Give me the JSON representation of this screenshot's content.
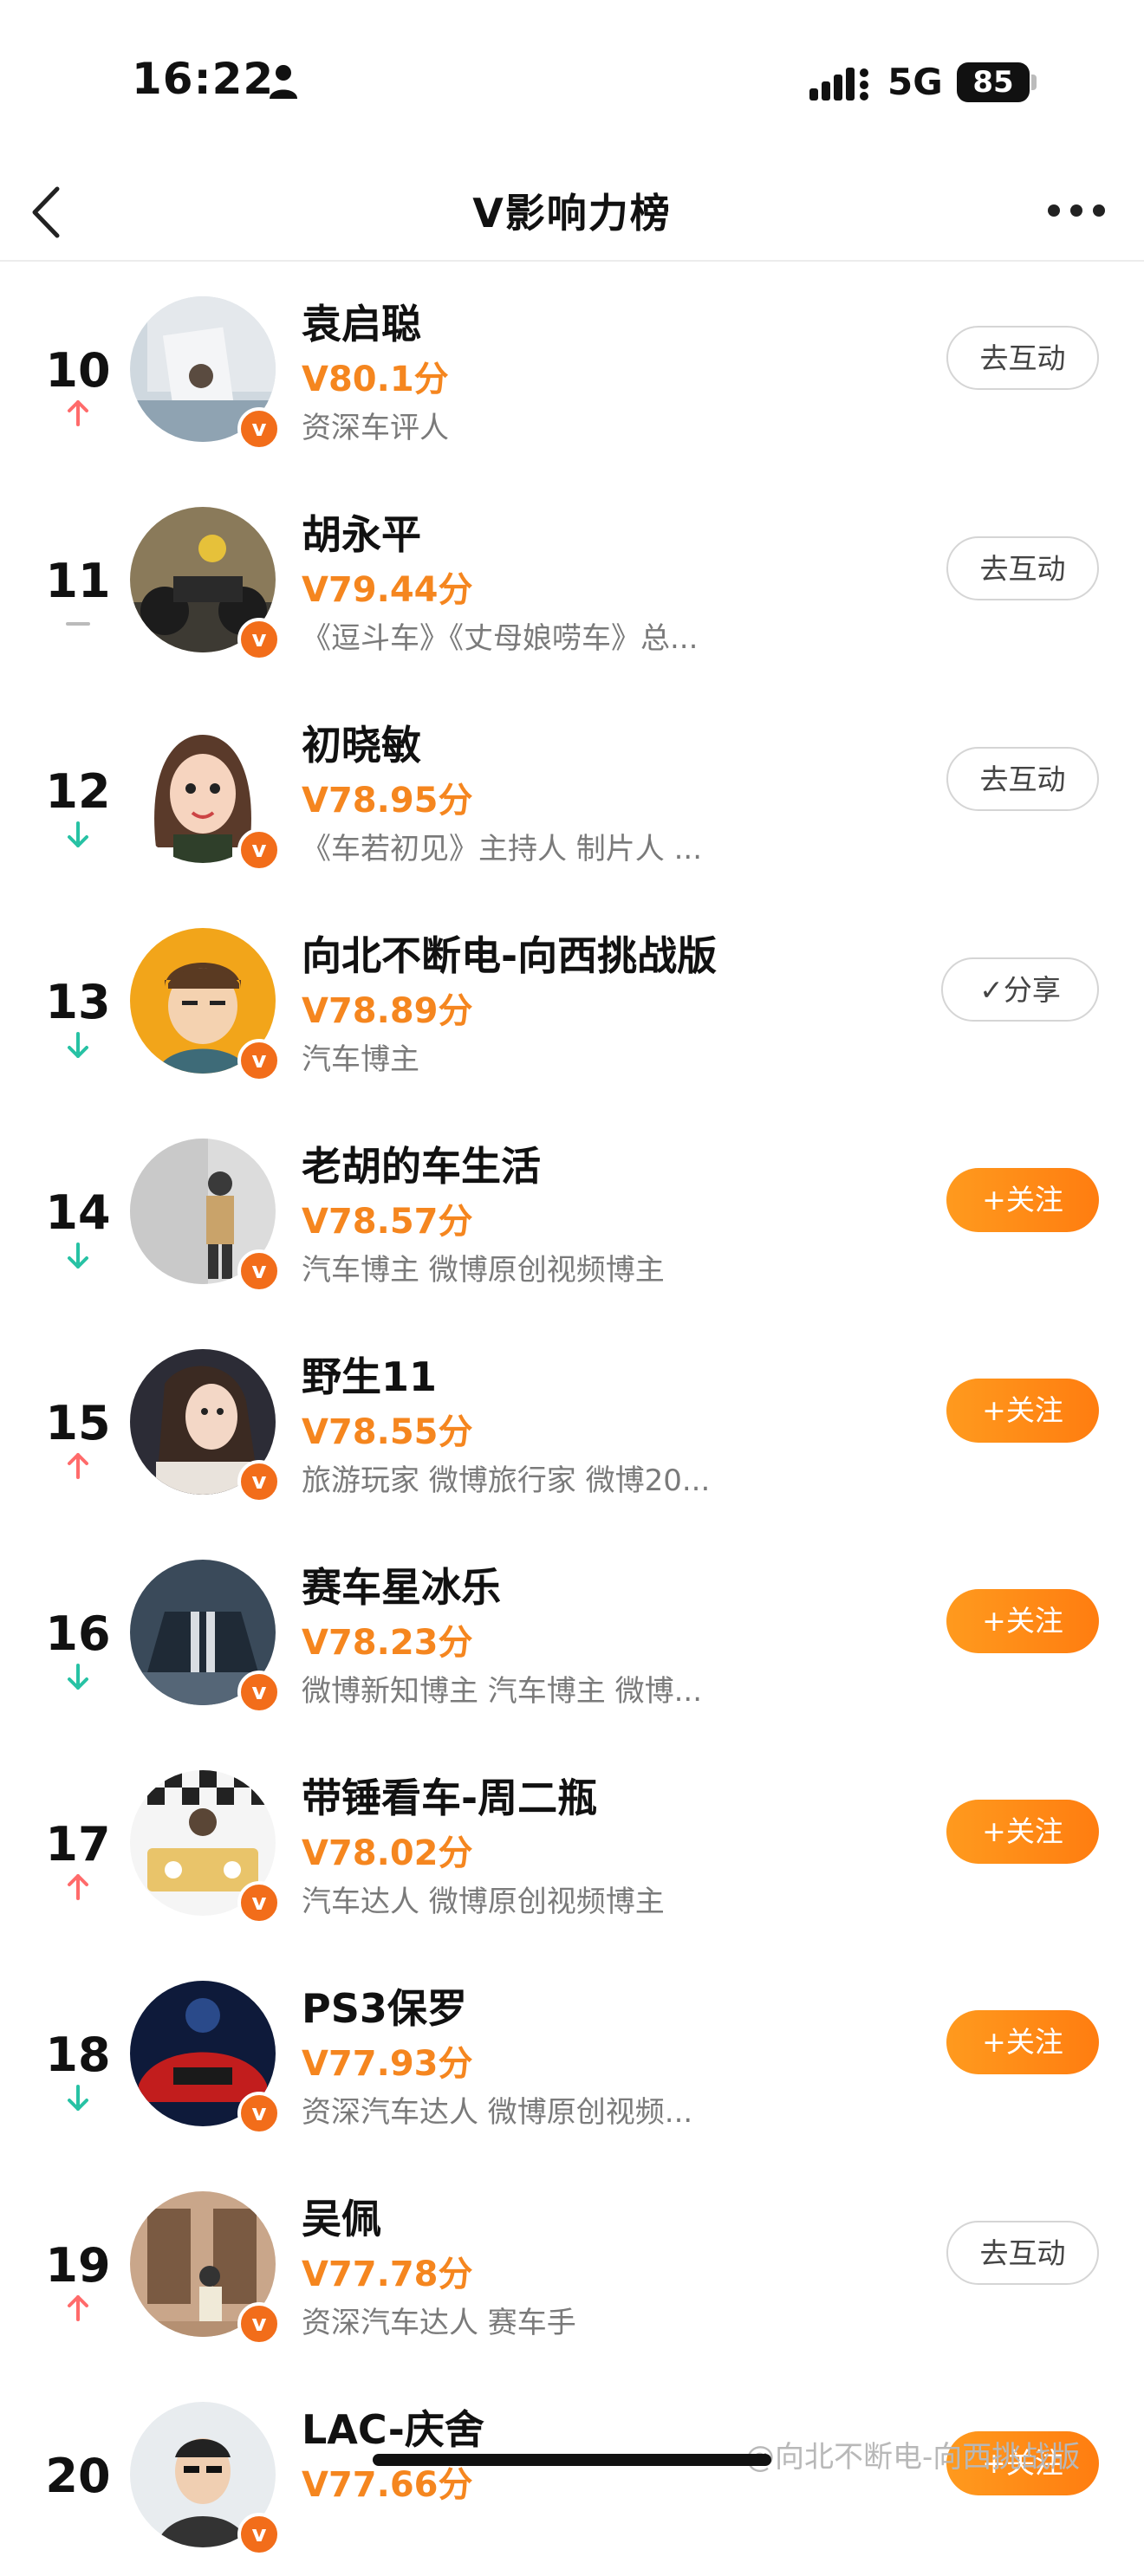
{
  "status_bar": {
    "time": "16:22",
    "network": "5G",
    "battery": "85"
  },
  "nav": {
    "title": "V影响力榜"
  },
  "colors": {
    "up": "#ff6b6b",
    "down": "#27c2a4",
    "same": "#bbbbbb",
    "accent": "#f5861f",
    "badge": "#f26d1a"
  },
  "rows": [
    {
      "rank": "10",
      "trend": "up",
      "name": "袁启聪",
      "score": "V80.1分",
      "desc": "资深车评人",
      "button": "去互动",
      "button_type": "outline",
      "avatar": "avatar-photo"
    },
    {
      "rank": "11",
      "trend": "same",
      "name": "胡永平",
      "score": "V79.44分",
      "desc": "《逗斗车》《丈母娘唠车》总...",
      "button": "去互动",
      "button_type": "outline",
      "avatar": "avatar-motorcycle"
    },
    {
      "rank": "12",
      "trend": "down",
      "name": "初晓敏",
      "score": "V78.95分",
      "desc": "《车若初见》主持人 制片人 ...",
      "button": "去互动",
      "button_type": "outline",
      "avatar": "avatar-cartoon-woman"
    },
    {
      "rank": "13",
      "trend": "down",
      "name": "向北不断电-向西挑战版",
      "score": "V78.89分",
      "desc": "汽车博主",
      "button": "✓分享",
      "button_type": "share",
      "avatar": "avatar-cartoon-man"
    },
    {
      "rank": "14",
      "trend": "down",
      "name": "老胡的车生活",
      "score": "V78.57分",
      "desc": "汽车博主 微博原创视频博主",
      "button": "+关注",
      "button_type": "follow",
      "avatar": "avatar-man-street"
    },
    {
      "rank": "15",
      "trend": "up",
      "name": "野生11",
      "score": "V78.55分",
      "desc": "旅游玩家 微博旅行家 微博20...",
      "button": "+关注",
      "button_type": "follow",
      "avatar": "avatar-woman"
    },
    {
      "rank": "16",
      "trend": "down",
      "name": "赛车星冰乐",
      "score": "V78.23分",
      "desc": "微博新知博主 汽车博主 微博...",
      "button": "+关注",
      "button_type": "follow",
      "avatar": "avatar-car"
    },
    {
      "rank": "17",
      "trend": "up",
      "name": "带锤看车-周二瓶",
      "score": "V78.02分",
      "desc": "汽车达人 微博原创视频博主",
      "button": "+关注",
      "button_type": "follow",
      "avatar": "avatar-jeep"
    },
    {
      "rank": "18",
      "trend": "down",
      "name": "PS3保罗",
      "score": "V77.93分",
      "desc": "资深汽车达人 微博原创视频...",
      "button": "+关注",
      "button_type": "follow",
      "avatar": "avatar-redcar"
    },
    {
      "rank": "19",
      "trend": "up",
      "name": "吴佩",
      "score": "V77.78分",
      "desc": "资深汽车达人 赛车手",
      "button": "去互动",
      "button_type": "outline",
      "avatar": "avatar-wall"
    },
    {
      "rank": "20",
      "trend": "",
      "name": "LAC-庆舍",
      "score": "V77.66分",
      "desc": "",
      "button": "+关注",
      "button_type": "follow",
      "avatar": "avatar-man"
    }
  ],
  "watermark": "@向北不断电-向西挑战版"
}
